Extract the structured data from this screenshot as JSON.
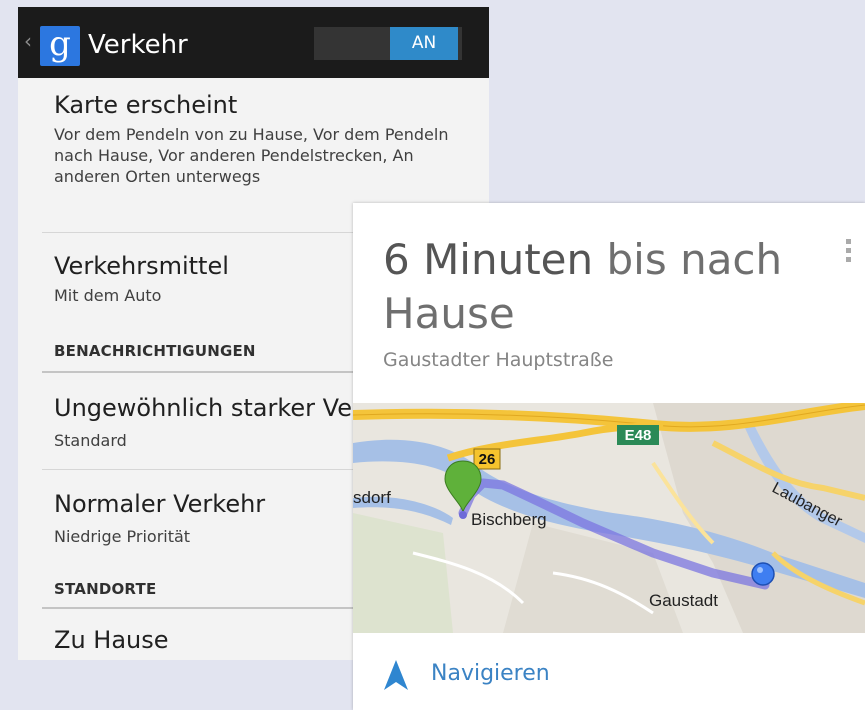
{
  "actionbar": {
    "title": "Verkehr",
    "logo_letter": "g",
    "toggle_label": "AN"
  },
  "preferences": [
    {
      "title": "Karte erscheint",
      "summary": "Vor dem Pendeln von zu Hause, Vor dem Pendeln nach Hause, Vor anderen Pendelstrecken, An anderen Orten unterwegs"
    },
    {
      "title": "Verkehrsmittel",
      "summary": "Mit dem Auto"
    },
    {
      "title": "Ungewöhnlich starker Verkehr",
      "summary": "Standard"
    },
    {
      "title": "Normaler Verkehr",
      "summary": "Niedrige Priorität"
    },
    {
      "title": "Zu Hause"
    }
  ],
  "sections": {
    "notifications": "BENACHRICHTIGUNGEN",
    "locations": "STANDORTE"
  },
  "card": {
    "title_bold": "6 Minuten",
    "title_rest": " bis nach Hause",
    "subtitle": "Gaustadter Hauptstraße",
    "nav_label": "Navigieren",
    "map": {
      "labels": {
        "e48": "E48",
        "road26": "26",
        "bischberg": "Bischberg",
        "sdorf": "sdorf",
        "gaustadt": "Gaustadt",
        "laubanger": "Laubanger"
      }
    }
  },
  "colors": {
    "accent": "#2f8ac9",
    "route": "#7b76e0",
    "nav": "#3b83c4"
  }
}
